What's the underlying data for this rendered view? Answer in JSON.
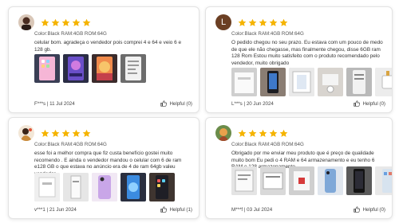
{
  "colors": {
    "star": "#f5b400",
    "helpful_text": "#444444",
    "border": "#e3e3e3"
  },
  "reviews": [
    {
      "avatar_type": "photo",
      "rating": 5,
      "variant": "Color:Black RAM:4GB ROM:64G",
      "text": "celular bom. agradeça o vendedor pois comprei 4 e 64 e veio 6 e 128 gb.",
      "photos": [
        "phone-pink-icons",
        "phone-wallpaper-purple",
        "phone-wallpaper-orange",
        "phone-settings-screen"
      ],
      "author": "F***s",
      "date": "11 Jul 2024",
      "helpful": "Helpful (0)"
    },
    {
      "avatar_type": "letter",
      "avatar_letter": "L",
      "rating": 5,
      "variant": "Color:Black RAM:4GB ROM:64G",
      "text": "O pedido chegou no seu prazo. Eu estava com um pouco de medo de que ele não chegasse, mas finalmente chegou, disse 6GB ram 128 Rom Estou muito satisfeito com o produto recomendado pelo vendedor, muito obrigado",
      "photos": [
        "phone-box-white",
        "phone-in-hand",
        "phone-box-open",
        "phone-accessories",
        "phone-settings",
        "phone-charger"
      ],
      "author": "L***s",
      "date": "20 Jun 2024",
      "helpful": "Helpful (0)"
    },
    {
      "avatar_type": "photo",
      "rating": 5,
      "variant": "Color:Black RAM:4GB ROM:64G",
      "text": "esse foi a melhor compra que fiz custa benefício gostei muito recomendo . E ainda o vendedor mandou o celular com 6 de ram e128 GB o que estava no anúncio era de 4 de ram 64gb valeu vendedor",
      "photos": [
        "phone-box-front",
        "phone-box-side",
        "phone-back-purple",
        "phone-screen-blue",
        "phone-home-screen"
      ],
      "author": "v***1",
      "date": "21 Jun 2024",
      "helpful": "Helpful (1)"
    },
    {
      "avatar_type": "photo",
      "rating": 5,
      "variant": "Color:Black RAM:4GB ROM:64G",
      "text": "Obrigado por me enviar meu produto que é preço de qualidade muito bom Eu pedi o 4 RAM e 64 armazenamento e eu tenho 6 RAM e 128 armazenamento.",
      "photos": [
        "phone-box-back",
        "phone-box-label",
        "phone-box-sticker",
        "phone-back-blue",
        "phone-front-black",
        "phone-front-light"
      ],
      "author": "M***f",
      "date": "03 Jul 2024",
      "helpful": "Helpful (0)"
    }
  ]
}
